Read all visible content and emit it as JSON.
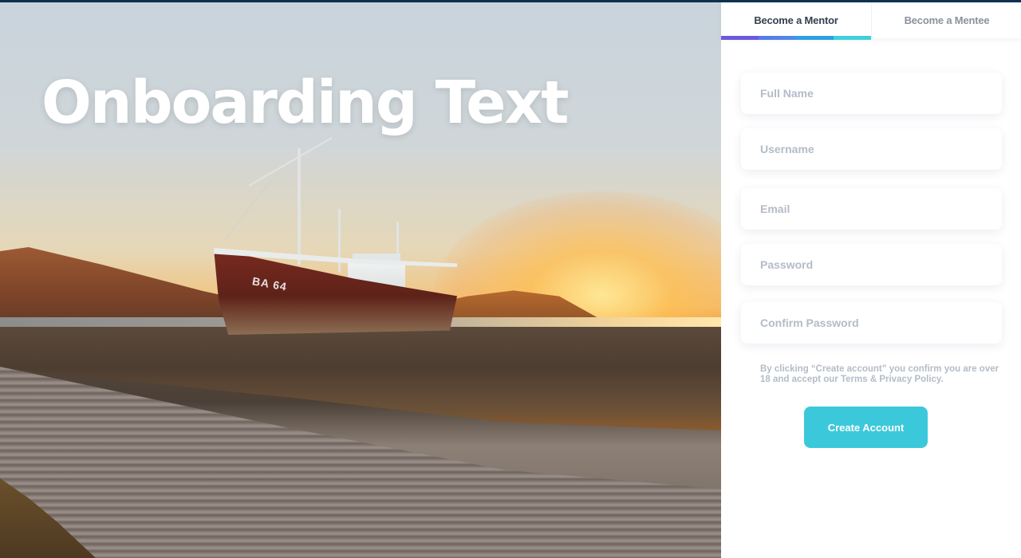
{
  "colors": {
    "accent": "#3cc8db",
    "top_line": "#0f3150",
    "tab_active_text": "#34404f",
    "tab_inactive_text": "#8a929c",
    "placeholder": "#b3bcc7"
  },
  "hero": {
    "title": "Onboarding Text",
    "image_text": "BA 64"
  },
  "tabs": [
    {
      "label": "Become a Mentor",
      "active": true
    },
    {
      "label": "Become a Mentee",
      "active": false
    }
  ],
  "form": {
    "full_name": {
      "placeholder": "Full Name",
      "value": ""
    },
    "username": {
      "placeholder": "Username",
      "value": ""
    },
    "email": {
      "placeholder": "Email",
      "value": ""
    },
    "password": {
      "placeholder": "Password",
      "value": ""
    },
    "confirm_password": {
      "placeholder": "Confirm Password",
      "value": ""
    },
    "legal_text": "By clicking “Create account” you confirm you are over 18 and accept our Terms & Privacy Policy.",
    "submit_label": "Create Account"
  }
}
